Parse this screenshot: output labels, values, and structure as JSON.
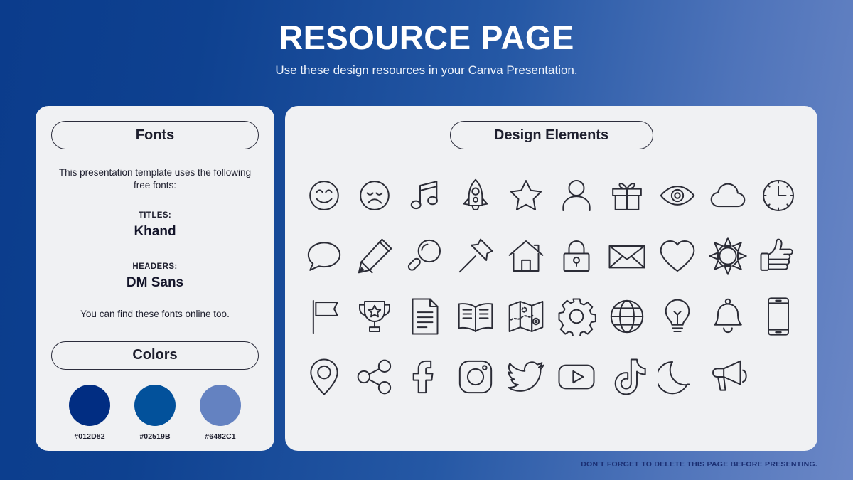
{
  "header": {
    "title": "RESOURCE PAGE",
    "subtitle": "Use these design resources in your Canva Presentation."
  },
  "fonts_panel": {
    "heading": "Fonts",
    "intro": "This presentation template uses the following free fonts:",
    "entries": [
      {
        "label": "TITLES:",
        "name": "Khand"
      },
      {
        "label": "HEADERS:",
        "name": "DM Sans"
      }
    ],
    "outro": "You can find these fonts online too."
  },
  "colors_panel": {
    "heading": "Colors",
    "swatches": [
      {
        "hex": "#012D82",
        "value": "#012D82"
      },
      {
        "hex": "#02519B",
        "value": "#02519B"
      },
      {
        "hex": "#6482C1",
        "value": "#6482C1"
      }
    ]
  },
  "elements_panel": {
    "heading": "Design Elements",
    "icons": [
      "smiley-face-icon",
      "sad-face-icon",
      "music-note-icon",
      "rocket-icon",
      "star-icon",
      "person-icon",
      "gift-icon",
      "eye-icon",
      "cloud-icon",
      "clock-icon",
      "speech-bubble-icon",
      "pencil-icon",
      "magnifying-glass-icon",
      "pushpin-icon",
      "house-icon",
      "lock-icon",
      "envelope-icon",
      "heart-icon",
      "sun-icon",
      "thumbs-up-icon",
      "flag-icon",
      "trophy-icon",
      "document-icon",
      "open-book-icon",
      "map-icon",
      "gear-icon",
      "globe-icon",
      "lightbulb-icon",
      "bell-icon",
      "phone-icon",
      "location-pin-icon",
      "share-icon",
      "facebook-icon",
      "instagram-icon",
      "twitter-icon",
      "youtube-icon",
      "tiktok-icon",
      "moon-icon",
      "megaphone-icon"
    ]
  },
  "footer": {
    "note": "DON'T FORGET TO DELETE THIS PAGE BEFORE PRESENTING."
  },
  "theme": {
    "gradient_start": "#0b3c8c",
    "gradient_end": "#6b87c6",
    "card_bg": "#f0f1f3",
    "ink": "#2b2c36"
  }
}
